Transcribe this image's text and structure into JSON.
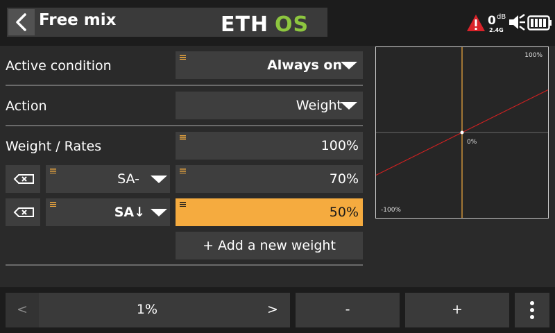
{
  "header": {
    "title": "Free mix",
    "logo_text": "ETHOS",
    "rssi_value": "0",
    "rssi_unit": "dB",
    "rssi_band": "2.4G",
    "icons": [
      "back-chevron-icon",
      "warning-icon",
      "speaker-icon",
      "battery-icon"
    ],
    "colors": {
      "accent": "#f5ab3f",
      "logo_green": "#8dc63f",
      "warning": "#d9232a",
      "curve": "#d12020"
    }
  },
  "form": {
    "active_condition": {
      "label": "Active condition",
      "value": "Always on"
    },
    "action": {
      "label": "Action",
      "value": "Weight"
    },
    "weight_rates": {
      "label": "Weight / Rates",
      "value": "100%"
    },
    "rates": [
      {
        "switch": "SA-",
        "value": "70%",
        "highlighted": false
      },
      {
        "switch": "SA↓",
        "value": "50%",
        "highlighted": true
      }
    ],
    "add_button": "+ Add a new weight"
  },
  "chart_data": {
    "type": "line",
    "x": [
      -100,
      100
    ],
    "series": [
      {
        "values": [
          -50,
          50
        ]
      }
    ],
    "xlim": [
      -100,
      100
    ],
    "ylim": [
      -100,
      100
    ],
    "current_x": 0,
    "labels": {
      "top_right": "100%",
      "center": "0%",
      "bottom_left": "-100%"
    },
    "grid": true
  },
  "footer": {
    "prev_label": "<",
    "value": "1%",
    "next_label": ">",
    "minus_label": "-",
    "plus_label": "+",
    "menu_icon": "vertical-dots-icon"
  }
}
